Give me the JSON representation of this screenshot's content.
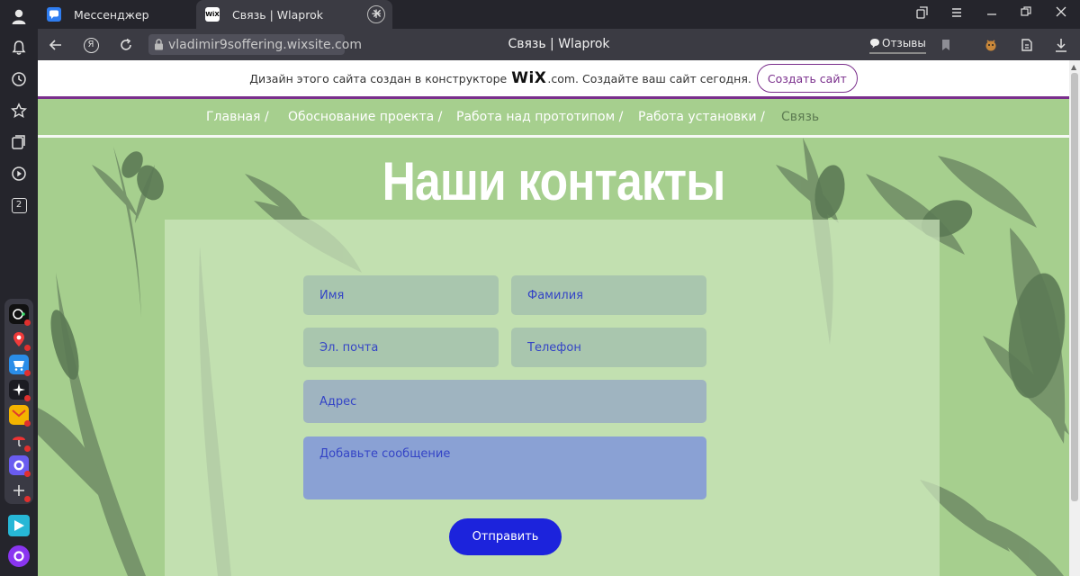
{
  "tabs": {
    "inactive": {
      "label": "Мессенджер"
    },
    "active": {
      "label": "Связь | Wlaprok",
      "favicon_text": "WiX"
    }
  },
  "sidebar": {
    "tab_count_badge": "2"
  },
  "addressbar": {
    "url": "vladimir9soffering.wixsite.com",
    "page_title": "Связь | Wlaprok",
    "reviews_label": "Отзывы",
    "yandex_glyph": "Я"
  },
  "wix_banner": {
    "text_before": "Дизайн этого сайта создан в конструкторе",
    "logo": "WiX",
    "text_after": ".com. Создайте ваш сайт сегодня.",
    "button_label": "Создать сайт"
  },
  "menu": {
    "items": [
      {
        "label": "Главная",
        "sep": "/"
      },
      {
        "label": "Обоснование проекта",
        "sep": "/"
      },
      {
        "label": "Работа над прототипом",
        "sep": "/"
      },
      {
        "label": "Работа установки",
        "sep": "/"
      },
      {
        "label": "Связь",
        "sep": ""
      }
    ]
  },
  "page": {
    "heading": "Наши контакты"
  },
  "form": {
    "first_name_placeholder": "Имя",
    "last_name_placeholder": "Фамилия",
    "email_placeholder": "Эл. почта",
    "phone_placeholder": "Телефон",
    "address_placeholder": "Адрес",
    "message_placeholder": "Добавьте сообщение",
    "submit_label": "Отправить"
  },
  "colors": {
    "page_bg": "#a6cf8e",
    "wix_accent": "#7a2e8c",
    "submit_bg": "#1c23dc",
    "field_text": "#3444c6"
  },
  "icons": {
    "sidebar": [
      "profile-icon",
      "bell-icon",
      "history-icon",
      "star-icon",
      "collections-icon",
      "video-icon",
      "tabs-counter-icon"
    ],
    "dock": [
      "timer-app-icon",
      "maps-app-icon",
      "market-app-icon",
      "ai-spark-app-icon",
      "mail-app-icon",
      "umbrella-app-icon",
      "messenger-app-icon",
      "add-app-icon",
      "music-app-icon",
      "alice-icon"
    ]
  }
}
